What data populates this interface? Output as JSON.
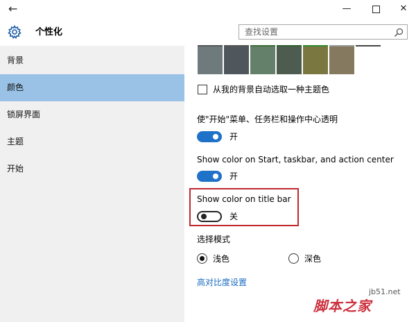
{
  "window": {
    "back_glyph": "←",
    "minimize_glyph": "—",
    "close_glyph": "✕"
  },
  "header": {
    "title": "个性化",
    "icon": "gear-icon"
  },
  "search": {
    "placeholder": "查找设置",
    "icon": "search-icon"
  },
  "sidebar": {
    "items": [
      {
        "label": "背景",
        "selected": false
      },
      {
        "label": "颜色",
        "selected": true
      },
      {
        "label": "锁屏界面",
        "selected": false
      },
      {
        "label": "主题",
        "selected": false
      },
      {
        "label": "开始",
        "selected": false
      }
    ]
  },
  "colors": {
    "swatches": [
      "#6e7a7c",
      "#4f575c",
      "#65806a",
      "#4e5c50",
      "#7a7840",
      "#85795f"
    ],
    "swatch_toplines": [
      "#555555",
      "#555555",
      "#3a6b3a",
      "#2e5e2e",
      "#2f8a2f",
      "#9a9a9a",
      "#444444"
    ],
    "sidebar_selected": "#99c2e6",
    "toggle_on": "#1e72c8",
    "highlight_border": "#c0272d",
    "link": "#1a6cc2"
  },
  "main": {
    "auto_color_label": "从我的背景自动选取一种主题色",
    "auto_color_checked": false,
    "transparency": {
      "label": "使\"开始\"菜单、任务栏和操作中心透明",
      "state_text": "开",
      "on": true
    },
    "show_color_start": {
      "label": "Show color on Start, taskbar, and action center",
      "state_text": "开",
      "on": true
    },
    "show_color_title": {
      "label": "Show color on title bar",
      "state_text": "关",
      "on": false
    },
    "mode": {
      "label": "选择模式",
      "options": [
        {
          "label": "浅色",
          "checked": true
        },
        {
          "label": "深色",
          "checked": false
        }
      ]
    },
    "high_contrast_link": "高对比度设置"
  },
  "watermark": {
    "url": "jb51.net",
    "text": "脚本之家"
  }
}
